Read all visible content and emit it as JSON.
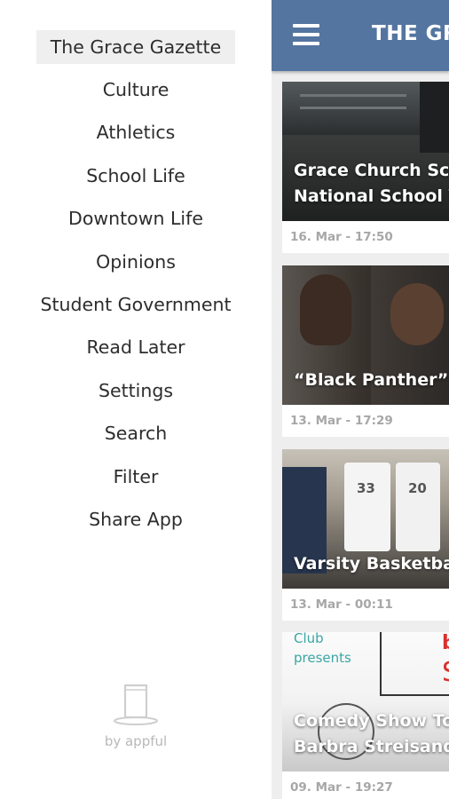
{
  "drawer": {
    "items": [
      {
        "label": "The Grace Gazette",
        "active": true
      },
      {
        "label": "Culture"
      },
      {
        "label": "Athletics"
      },
      {
        "label": "School Life"
      },
      {
        "label": "Downtown Life"
      },
      {
        "label": "Opinions"
      },
      {
        "label": "Student Government"
      },
      {
        "label": "Read Later"
      },
      {
        "label": "Settings"
      },
      {
        "label": "Search"
      },
      {
        "label": "Filter"
      },
      {
        "label": "Share App"
      }
    ],
    "footer": {
      "brand": "by appful",
      "icon": "cup-icon"
    }
  },
  "header": {
    "title": "THE GR",
    "menu_icon": "hamburger-icon",
    "color": "#5475a0"
  },
  "articles": [
    {
      "title": "Grace Church Sch\nNational School ",
      "title_lines": [
        "Grace Church Sch",
        "National School \\"
      ],
      "date": "16. Mar - 17:50"
    },
    {
      "title_lines": [
        "“Black Panther” I"
      ],
      "date": "13. Mar - 17:29"
    },
    {
      "title_lines": [
        "Varsity Basketba"
      ],
      "date": "13. Mar - 00:11"
    },
    {
      "title_lines": [
        "Comedy Show To",
        "Barbra Streisand"
      ],
      "date": "09. Mar - 19:27",
      "overlay_text": [
        "Club",
        "presents"
      ]
    }
  ]
}
